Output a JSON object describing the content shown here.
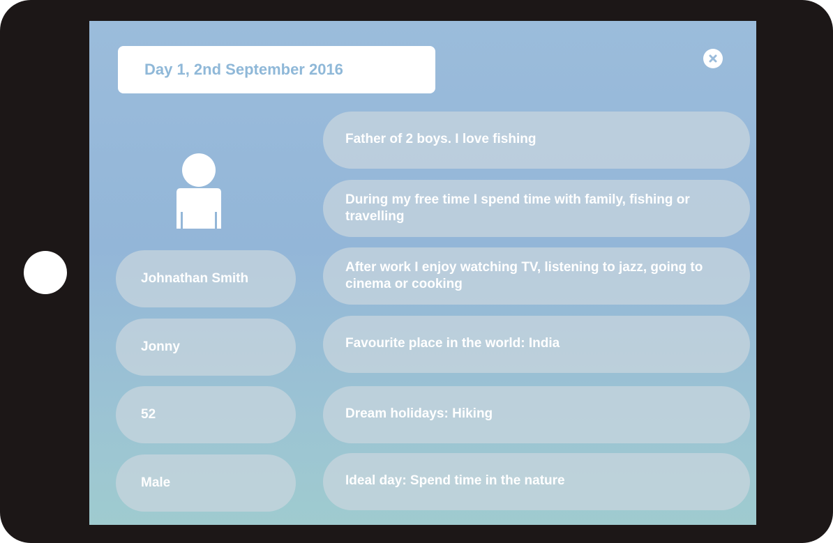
{
  "header": {
    "date_label": "Day 1, 2nd September 2016"
  },
  "profile": {
    "full_name": "Johnathan Smith",
    "nickname": "Jonny",
    "age": "52",
    "gender": "Male"
  },
  "facts": [
    "Father of 2 boys. I love fishing",
    "During my free time I spend time with family, fishing or travelling",
    "After work I enjoy watching TV, listening to jazz, going to cinema or cooking",
    "Favourite place in the world: India",
    "Dream holidays: Hiking",
    "Ideal day: Spend time in the nature"
  ],
  "icons": {
    "close": "close-icon",
    "avatar": "person-icon"
  },
  "colors": {
    "bezel": "#1c1717",
    "screen_top": "#9bbcdb",
    "screen_bottom": "#9fcbcf",
    "date_text": "#8fb8d8",
    "pill_text": "#ffffff"
  }
}
